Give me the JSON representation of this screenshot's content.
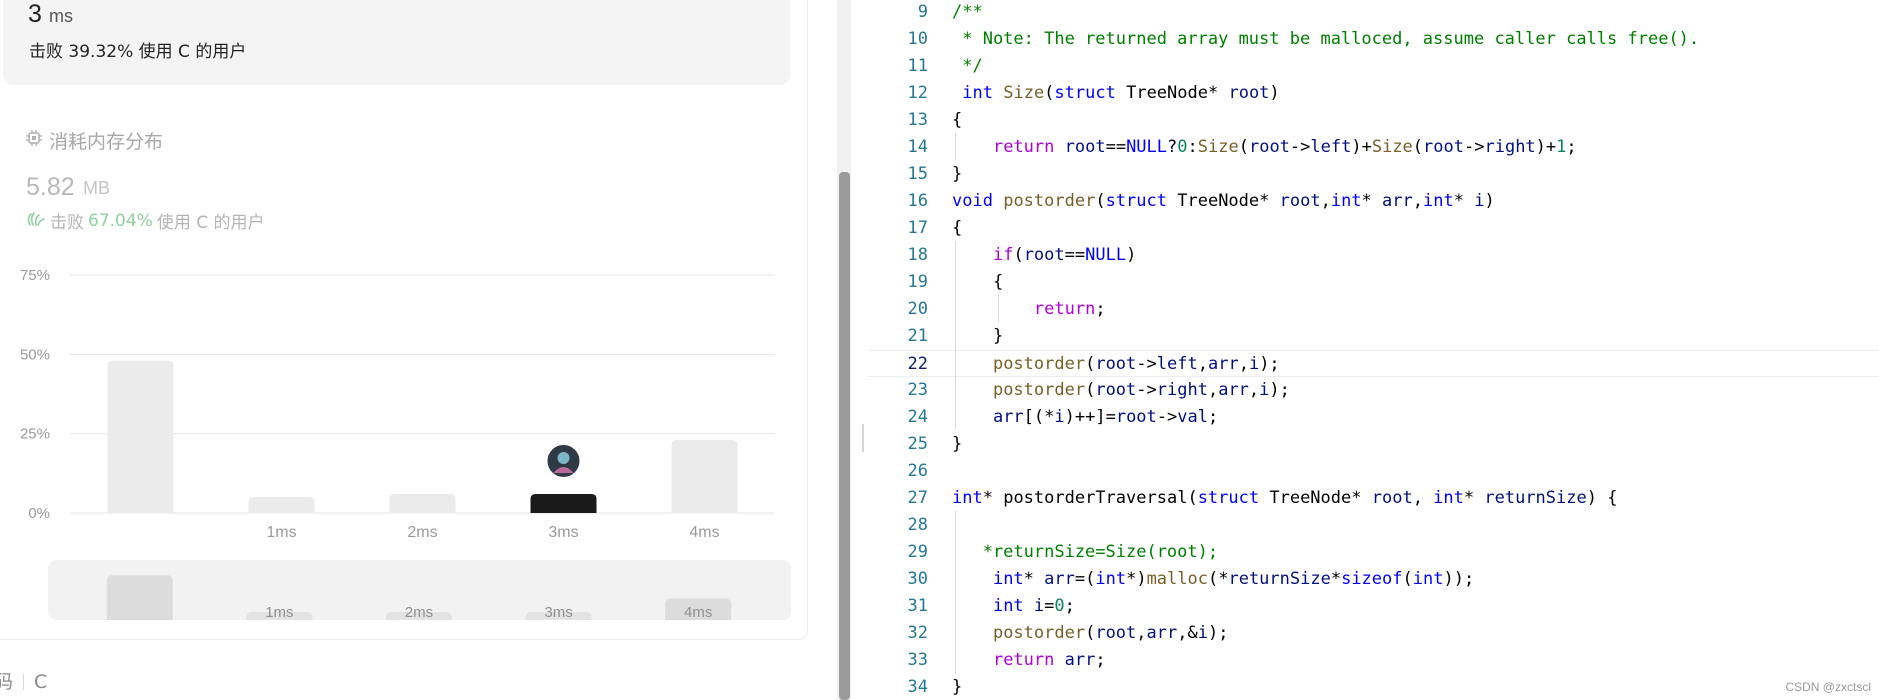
{
  "runtime": {
    "value": "3",
    "unit": "ms",
    "beats_prefix": "击败",
    "beats_percent": "39.32%",
    "beats_suffix": "使用 C 的用户"
  },
  "memory": {
    "title": "消耗内存分布",
    "value": "5.82",
    "unit": "MB",
    "beats_prefix": "击败",
    "beats_percent": "67.04%",
    "beats_suffix": "使用 C 的用户"
  },
  "distribution_chart": {
    "y_ticks": [
      "75%",
      "50%",
      "25%",
      "0%"
    ],
    "categories": [
      "",
      "1ms",
      "2ms",
      "3ms",
      "4ms"
    ],
    "values": [
      48,
      5,
      6,
      6,
      23
    ],
    "highlight_index": 3,
    "y_max": 75,
    "colors": {
      "bar": "#ebebeb",
      "highlight": "#1a1a1a",
      "grid": "#e6e6e6",
      "label": "#9a9a9a"
    }
  },
  "minimap": {
    "categories": [
      "",
      "1ms",
      "2ms",
      "3ms",
      "4ms"
    ],
    "values": [
      48,
      5,
      6,
      6,
      23
    ]
  },
  "footer": {
    "left": "码",
    "lang": "C"
  },
  "code": {
    "lines": [
      {
        "n": "9",
        "t": "/**"
      },
      {
        "n": "10",
        "t": " * Note: The returned array must be malloced, assume caller calls free()."
      },
      {
        "n": "11",
        "t": " */"
      },
      {
        "n": "12",
        "t": " int Size(struct TreeNode* root)"
      },
      {
        "n": "13",
        "t": "{"
      },
      {
        "n": "14",
        "t": "    return root==NULL?0:Size(root->left)+Size(root->right)+1;"
      },
      {
        "n": "15",
        "t": "}"
      },
      {
        "n": "16",
        "t": "void postorder(struct TreeNode* root,int* arr,int* i)"
      },
      {
        "n": "17",
        "t": "{"
      },
      {
        "n": "18",
        "t": "    if(root==NULL)"
      },
      {
        "n": "19",
        "t": "    {"
      },
      {
        "n": "20",
        "t": "        return;"
      },
      {
        "n": "21",
        "t": "    }"
      },
      {
        "n": "22",
        "t": "    postorder(root->left,arr,i);"
      },
      {
        "n": "23",
        "t": "    postorder(root->right,arr,i);"
      },
      {
        "n": "24",
        "t": "    arr[(*i)++]=root->val;"
      },
      {
        "n": "25",
        "t": "}"
      },
      {
        "n": "26",
        "t": ""
      },
      {
        "n": "27",
        "t": "int* postorderTraversal(struct TreeNode* root, int* returnSize) {"
      },
      {
        "n": "28",
        "t": ""
      },
      {
        "n": "29",
        "t": "   *returnSize=Size(root);"
      },
      {
        "n": "30",
        "t": "    int* arr=(int*)malloc(*returnSize*sizeof(int));"
      },
      {
        "n": "31",
        "t": "    int i=0;"
      },
      {
        "n": "32",
        "t": "    postorder(root,arr,&i);"
      },
      {
        "n": "33",
        "t": "    return arr;"
      },
      {
        "n": "34",
        "t": "}"
      }
    ],
    "current_line": "22"
  },
  "watermark": "CSDN @zxctscl"
}
